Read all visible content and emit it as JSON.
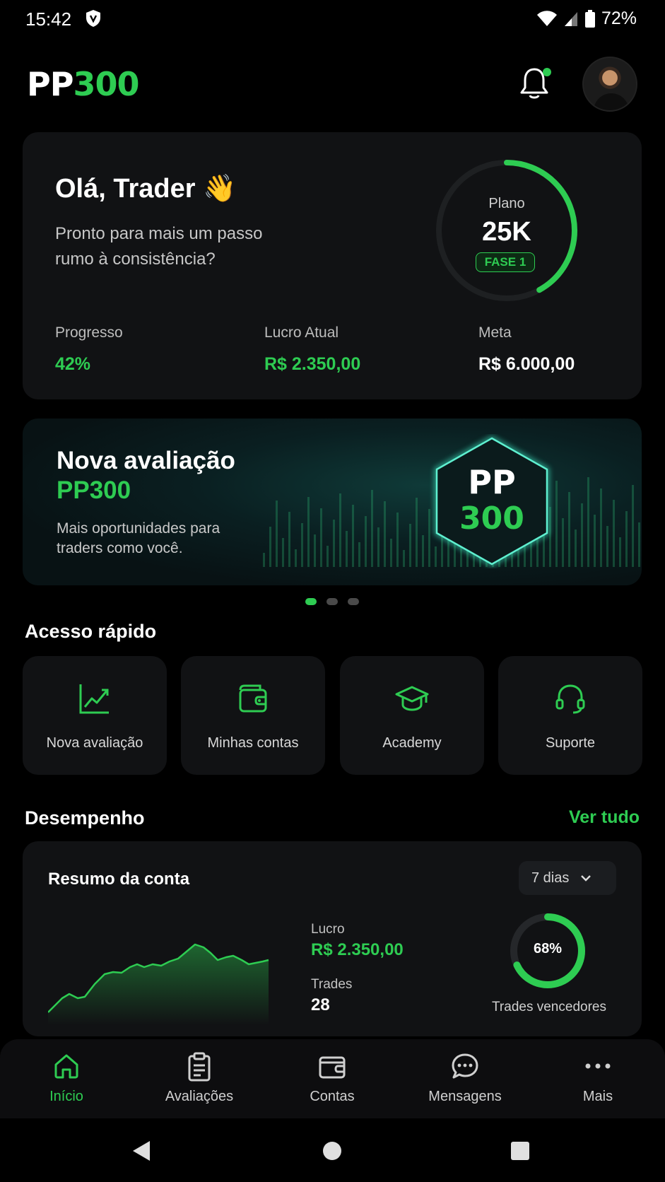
{
  "status_bar": {
    "time": "15:42",
    "battery": "72%"
  },
  "header": {
    "logo_a": "PP",
    "logo_b": "300"
  },
  "hero": {
    "greeting": "Olá, Trader 👋",
    "subtitle": "Pronto para mais um passo rumo à consistência?",
    "plan_label": "Plano",
    "plan_value": "25K",
    "phase_badge": "FASE 1",
    "ring_progress": 0.42,
    "stats": [
      {
        "label": "Progresso",
        "value": "42%"
      },
      {
        "label": "Lucro Atual",
        "value": "R$ 2.350,00"
      },
      {
        "label": "Meta",
        "value": "R$ 6.000,00"
      }
    ]
  },
  "banner": {
    "title": "Nova avaliação",
    "brand": "PP300",
    "description": "Mais oportunidades para traders como você.",
    "badge_top": "PP",
    "badge_bottom": "300"
  },
  "quick_access": {
    "title": "Acesso rápido",
    "items": [
      {
        "label": "Nova avaliação",
        "icon": "chart-line-icon"
      },
      {
        "label": "Minhas contas",
        "icon": "wallet-icon"
      },
      {
        "label": "Academy",
        "icon": "graduation-cap-icon"
      },
      {
        "label": "Suporte",
        "icon": "headset-icon"
      }
    ]
  },
  "performance": {
    "title": "Desempenho",
    "see_all": "Ver tudo",
    "card_title": "Resumo da conta",
    "range_select": "7 dias",
    "profit_label": "Lucro",
    "profit_value": "R$ 2.350,00",
    "trades_label": "Trades",
    "trades_value": "28",
    "win_rate": "68%",
    "win_rate_value": 0.68,
    "win_rate_label": "Trades vencedores"
  },
  "bottom_nav": [
    {
      "label": "Início",
      "icon": "home-icon",
      "active": true
    },
    {
      "label": "Avaliações",
      "icon": "clipboard-icon",
      "active": false
    },
    {
      "label": "Contas",
      "icon": "wallet-icon",
      "active": false
    },
    {
      "label": "Mensagens",
      "icon": "chat-icon",
      "active": false
    },
    {
      "label": "Mais",
      "icon": "more-icon",
      "active": false
    }
  ],
  "colors": {
    "accent": "#2ecc52",
    "card": "#111214",
    "background": "#000000"
  }
}
